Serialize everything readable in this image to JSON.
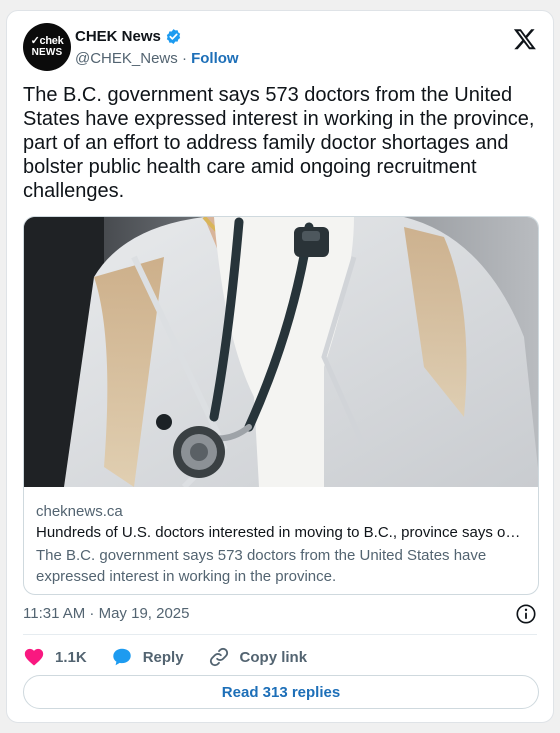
{
  "tweet": {
    "author": {
      "name": "CHEK News",
      "handle": "@CHEK_News",
      "separator": "·",
      "follow_label": "Follow",
      "avatar_line1": "chek",
      "avatar_line2": "NEWS"
    },
    "text": "The B.C. government says 573 doctors from the United States have expressed interest in working in the province, part of an effort to address family doctor shortages and bolster public health care amid ongoing recruitment challenges.",
    "link_card": {
      "domain": "cheknews.ca",
      "title": "Hundreds of U.S. doctors interested in moving to B.C., province says o…",
      "description": "The B.C. government says 573 doctors from the United States have expressed interest in working in the province."
    },
    "timestamp": "11:31 AM · May 19, 2025",
    "actions": {
      "likes_count": "1.1K",
      "reply_label": "Reply",
      "copy_link_label": "Copy link"
    },
    "read_replies_label": "Read 313 replies"
  },
  "colors": {
    "link_blue": "#1d6fb8",
    "verified_blue": "#1d9bf0",
    "like_pink": "#f91880",
    "text_gray": "#536471"
  },
  "icons": [
    "verified-badge-icon",
    "x-logo-icon",
    "info-icon",
    "heart-icon",
    "speech-bubble-icon",
    "link-icon"
  ]
}
